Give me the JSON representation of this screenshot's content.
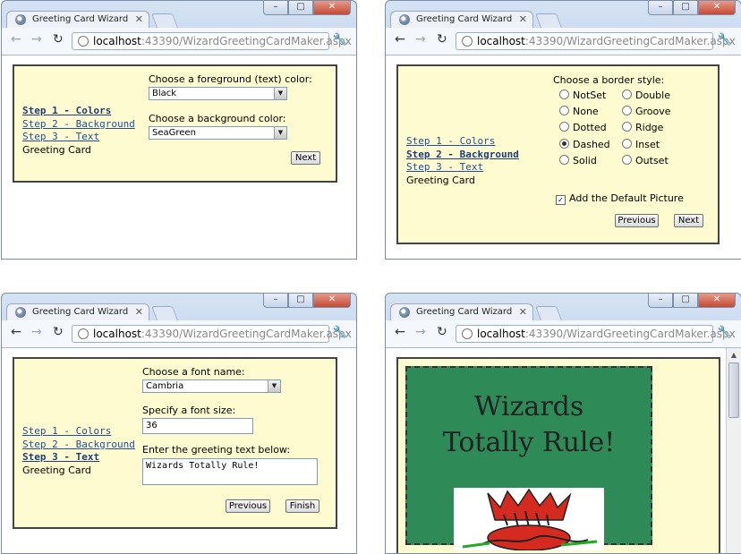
{
  "browser": {
    "tab_title": "Greeting Card Wizard",
    "url_host": "localhost",
    "url_rest": ":43390/WizardGreetingCardMaker.aspx"
  },
  "steps": {
    "step1": "Step 1 - Colors",
    "step2": "Step 2 - Background",
    "step3": "Step 3 - Text",
    "card": "Greeting Card"
  },
  "w1": {
    "fg_label": "Choose a foreground (text) color:",
    "fg_value": "Black",
    "bg_label": "Choose a background color:",
    "bg_value": "SeaGreen",
    "next": "Next"
  },
  "w2": {
    "border_label": "Choose a border style:",
    "options": [
      "NotSet",
      "Double",
      "None",
      "Groove",
      "Dotted",
      "Ridge",
      "Dashed",
      "Inset",
      "Solid",
      "Outset"
    ],
    "selected": "Dashed",
    "picture_label": "Add the Default Picture",
    "previous": "Previous",
    "next": "Next"
  },
  "w3": {
    "font_label": "Choose a font name:",
    "font_value": "Cambria",
    "size_label": "Specify a font size:",
    "size_value": "36",
    "text_label": "Enter the greeting text below:",
    "text_value": "Wizards Totally Rule!",
    "previous": "Previous",
    "finish": "Finish"
  },
  "w4": {
    "line1": "Wizards",
    "line2": "Totally Rule!",
    "card_color": "#2e8b57"
  }
}
